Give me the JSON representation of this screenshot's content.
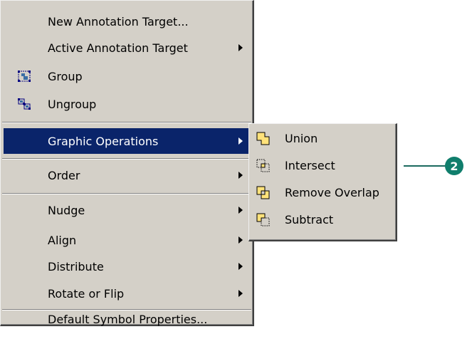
{
  "main_menu": {
    "new_annotation_target": "New Annotation Target...",
    "active_annotation_target": "Active Annotation Target",
    "group": "Group",
    "ungroup": "Ungroup",
    "graphic_operations": "Graphic Operations",
    "order": "Order",
    "nudge": "Nudge",
    "align": "Align",
    "distribute": "Distribute",
    "rotate_or_flip": "Rotate or Flip",
    "default_symbol_properties": "Default Symbol Properties..."
  },
  "sub_menu": {
    "union": "Union",
    "intersect": "Intersect",
    "remove_overlap": "Remove Overlap",
    "subtract": "Subtract"
  },
  "callout": {
    "number": "2"
  },
  "colors": {
    "menu_bg": "#d4d0c8",
    "selection_bg": "#0a246a",
    "callout": "#107e6c",
    "shape_fill": "#ffe27a"
  },
  "icons": [
    "group-icon",
    "ungroup-icon",
    "union-icon",
    "intersect-icon",
    "remove-overlap-icon",
    "subtract-icon"
  ]
}
